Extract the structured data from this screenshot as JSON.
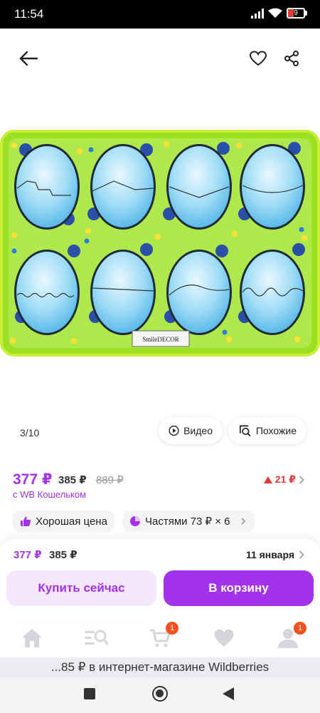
{
  "status_bar": {
    "time": "11:54",
    "battery_level": "9"
  },
  "gallery": {
    "counter": "3/10",
    "video_label": "Видео",
    "similar_label": "Похожие"
  },
  "product_image": {
    "brand_label": "SmileDECOR"
  },
  "price": {
    "current": "377 ₽",
    "wallet": "385 ₽",
    "old": "889 ₽",
    "wallet_note": "с WB Кошельком",
    "change": "21 ₽"
  },
  "chips": {
    "good_price": "Хорошая цена",
    "installments": "Частями 73 ₽ × 6"
  },
  "buy_sheet": {
    "price": "377 ₽",
    "wallet_price": "385 ₽",
    "delivery_date": "11 января",
    "buy_now_label": "Купить сейчас",
    "cart_label": "В корзину"
  },
  "bottom_nav": {
    "items": [
      {
        "icon": "home-icon"
      },
      {
        "icon": "catalog-search-icon"
      },
      {
        "icon": "cart-icon",
        "badge": "1"
      },
      {
        "icon": "heart-icon"
      },
      {
        "icon": "profile-icon",
        "badge": "1"
      }
    ]
  },
  "footer": {
    "text": "...85 ₽ в интернет-магазине Wildberries"
  },
  "colors": {
    "accent": "#a332ec",
    "accent_light": "#f3e6fd",
    "alert": "#e53935",
    "board_green": "#9be023",
    "egg_blue": "#8fd6f2"
  }
}
